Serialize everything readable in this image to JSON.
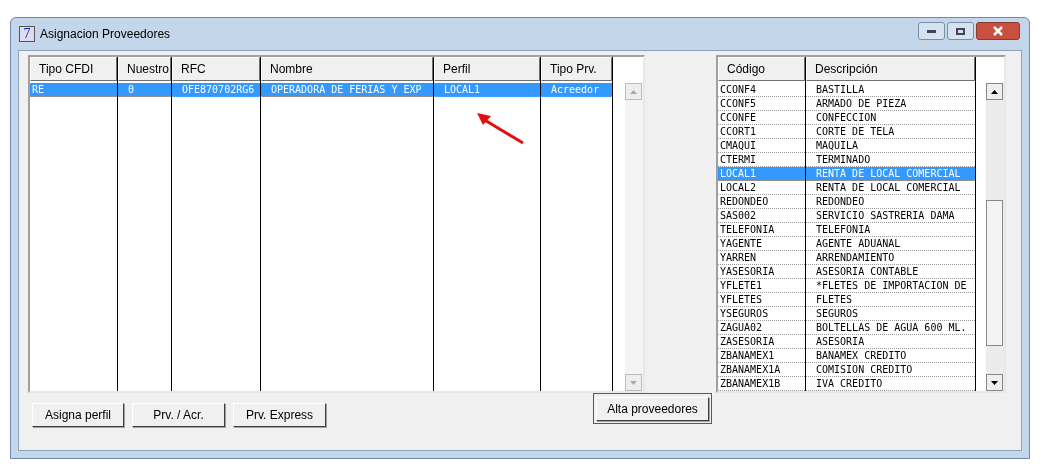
{
  "window": {
    "title": "Asignacion Proveedores",
    "app_icon": "7"
  },
  "left_table": {
    "columns": [
      "Tipo CFDI",
      "Nuestro",
      "RFC",
      "Nombre",
      "Perfil",
      "Tipo Prv."
    ],
    "rows": [
      {
        "cells": [
          "RE",
          "0",
          "OFE870702RG6",
          "OPERADORA DE FERIAS Y EXP",
          "LOCAL1",
          "Acreedor"
        ],
        "selected": true
      }
    ]
  },
  "right_table": {
    "columns": [
      "Código",
      "Descripción"
    ],
    "rows": [
      {
        "cells": [
          "CCONF4",
          "BASTILLA"
        ],
        "selected": false
      },
      {
        "cells": [
          "CCONF5",
          "ARMADO DE PIEZA"
        ],
        "selected": false
      },
      {
        "cells": [
          "CCONFE",
          "CONFECCION"
        ],
        "selected": false
      },
      {
        "cells": [
          "CCORT1",
          "CORTE DE TELA"
        ],
        "selected": false
      },
      {
        "cells": [
          "CMAQUI",
          "MAQUILA"
        ],
        "selected": false
      },
      {
        "cells": [
          "CTERMI",
          "TERMINADO"
        ],
        "selected": false
      },
      {
        "cells": [
          "LOCAL1",
          "RENTA DE LOCAL COMERCIAL"
        ],
        "selected": true
      },
      {
        "cells": [
          "LOCAL2",
          "RENTA DE LOCAL COMERCIAL"
        ],
        "selected": false
      },
      {
        "cells": [
          "REDONDEO",
          "REDONDEO"
        ],
        "selected": false
      },
      {
        "cells": [
          "SAS002",
          "SERVICIO SASTRERIA DAMA"
        ],
        "selected": false
      },
      {
        "cells": [
          "TELEFONIA",
          "TELEFONIA"
        ],
        "selected": false
      },
      {
        "cells": [
          "YAGENTE",
          "AGENTE ADUANAL"
        ],
        "selected": false
      },
      {
        "cells": [
          "YARREN",
          "ARRENDAMIENTO"
        ],
        "selected": false
      },
      {
        "cells": [
          "YASESORIA",
          "ASESORIA CONTABLE"
        ],
        "selected": false
      },
      {
        "cells": [
          "YFLETE1",
          "*FLETES DE IMPORTACION DE"
        ],
        "selected": false
      },
      {
        "cells": [
          "YFLETES",
          "FLETES"
        ],
        "selected": false
      },
      {
        "cells": [
          "YSEGUROS",
          "SEGUROS"
        ],
        "selected": false
      },
      {
        "cells": [
          "ZAGUA02",
          "BOLTELLAS DE AGUA 600 ML."
        ],
        "selected": false
      },
      {
        "cells": [
          "ZASESORIA",
          "ASESORIA"
        ],
        "selected": false
      },
      {
        "cells": [
          "ZBANAMEX1",
          "BANAMEX CREDITO"
        ],
        "selected": false
      },
      {
        "cells": [
          "ZBANAMEX1A",
          "COMISION CREDITO"
        ],
        "selected": false
      },
      {
        "cells": [
          "ZBANAMEX1B",
          "IVA CREDITO"
        ],
        "selected": false
      }
    ]
  },
  "buttons": [
    {
      "label": "Asigna perfil",
      "highlighted": false
    },
    {
      "label": "Prv. / Acr.",
      "highlighted": false
    },
    {
      "label": "Prv. Express",
      "highlighted": false
    },
    {
      "label": "Alta proveedores",
      "highlighted": true
    }
  ]
}
